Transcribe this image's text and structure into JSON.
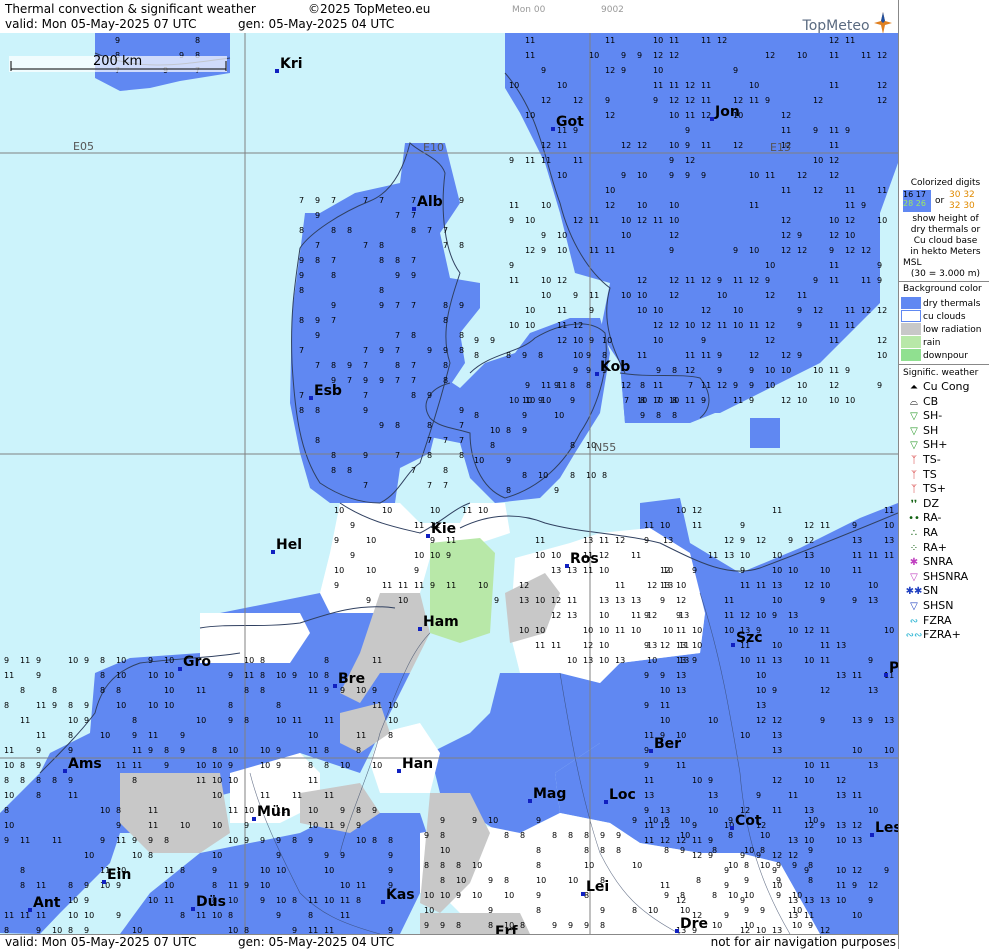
{
  "header": {
    "title": "Thermal convection & significant weather",
    "copyright": "©2025 TopMeteo.eu",
    "valid": "valid:  Mon  05-May-2025  07 UTC",
    "gen": "gen: 05-May-2025 04 UTC",
    "small_code1": "Mon 00",
    "small_code2": "9002",
    "logo": "TopMeteo"
  },
  "footer": {
    "valid": "valid:  Mon  05-May-2025  07 UTC",
    "gen": "gen: 05-May-2025 04 UTC",
    "disclaimer": "not for air navigation purposes"
  },
  "map": {
    "scale_label": "200 km",
    "grid_labels": [
      "E05",
      "E10",
      "E15",
      "N55"
    ],
    "cities": [
      "Kri",
      "Got",
      "Jon",
      "Alb",
      "Esb",
      "Kob",
      "Kie",
      "Hel",
      "Ros",
      "Ham",
      "Gro",
      "Bre",
      "Szc",
      "Ams",
      "Han",
      "Ber",
      "Mag",
      "Loc",
      "Mün",
      "Cot",
      "Les",
      "Ein",
      "Lei",
      "Kas",
      "Ant",
      "Düs",
      "Dre",
      "Erf",
      "P"
    ],
    "colors": {
      "sea": "#ccf3fb",
      "dry_thermals": "#6088f2",
      "cu_clouds": "#ffffff",
      "low_radiation": "#c8c8c8",
      "rain": "#b8e8a8",
      "downpour": "#90e090",
      "coast": "#304060",
      "grid": "#808080"
    }
  },
  "legend": {
    "colorized_title": "Colorized digits",
    "digit_samples": [
      "16 17",
      "30 32",
      "28 26",
      "32 30"
    ],
    "or": "or",
    "description": [
      "show height of",
      "dry thermals or",
      "Cu cloud base",
      "in hekto Meters",
      "MSL",
      "(30 = 3.000 m)"
    ],
    "background_title": "Background color",
    "background_items": [
      {
        "label": "dry thermals",
        "color": "#6088f2"
      },
      {
        "label": "cu clouds",
        "color": "#ffffff"
      },
      {
        "label": "low radiation",
        "color": "#c8c8c8"
      },
      {
        "label": "rain",
        "color": "#b8e8a8"
      },
      {
        "label": "downpour",
        "color": "#90e090"
      }
    ],
    "weather_title": "Signific. weather",
    "weather_items": [
      {
        "label": "Cu Cong",
        "icon": "cu-cong-icon",
        "glyph": "⏶",
        "color": "#000000"
      },
      {
        "label": "CB",
        "icon": "cb-icon",
        "glyph": "⌓",
        "color": "#000000"
      },
      {
        "label": "SH-",
        "icon": "shower-light-icon",
        "glyph": "▽",
        "color": "#2a9a2a"
      },
      {
        "label": "SH",
        "icon": "shower-icon",
        "glyph": "▽",
        "color": "#2a9a2a"
      },
      {
        "label": "SH+",
        "icon": "shower-heavy-icon",
        "glyph": "▽",
        "color": "#2a9a2a"
      },
      {
        "label": "TS-",
        "icon": "thunderstorm-light-icon",
        "glyph": "ᛉ",
        "color": "#d02020"
      },
      {
        "label": "TS",
        "icon": "thunderstorm-icon",
        "glyph": "ᛉ",
        "color": "#d02020"
      },
      {
        "label": "TS+",
        "icon": "thunderstorm-heavy-icon",
        "glyph": "ᛉ",
        "color": "#d02020"
      },
      {
        "label": "DZ",
        "icon": "drizzle-icon",
        "glyph": "❜❜",
        "color": "#106010"
      },
      {
        "label": "RA-",
        "icon": "rain-light-icon",
        "glyph": "••",
        "color": "#106010"
      },
      {
        "label": "RA",
        "icon": "rain-icon",
        "glyph": "∴",
        "color": "#106010"
      },
      {
        "label": "RA+",
        "icon": "rain-heavy-icon",
        "glyph": "⁘",
        "color": "#106010"
      },
      {
        "label": "SNRA",
        "icon": "snow-rain-icon",
        "glyph": "✱",
        "color": "#c040c0"
      },
      {
        "label": "SHSNRA",
        "icon": "snow-rain-shower-icon",
        "glyph": "▽",
        "color": "#c040c0"
      },
      {
        "label": "SN",
        "icon": "snow-icon",
        "glyph": "✱✱",
        "color": "#2040c0"
      },
      {
        "label": "SHSN",
        "icon": "snow-shower-icon",
        "glyph": "▽",
        "color": "#2040c0"
      },
      {
        "label": "FZRA",
        "icon": "freezing-rain-icon",
        "glyph": "∾",
        "color": "#20b0d0"
      },
      {
        "label": "FZRA+",
        "icon": "freezing-rain-heavy-icon",
        "glyph": "∾∾",
        "color": "#20b0d0"
      }
    ]
  }
}
